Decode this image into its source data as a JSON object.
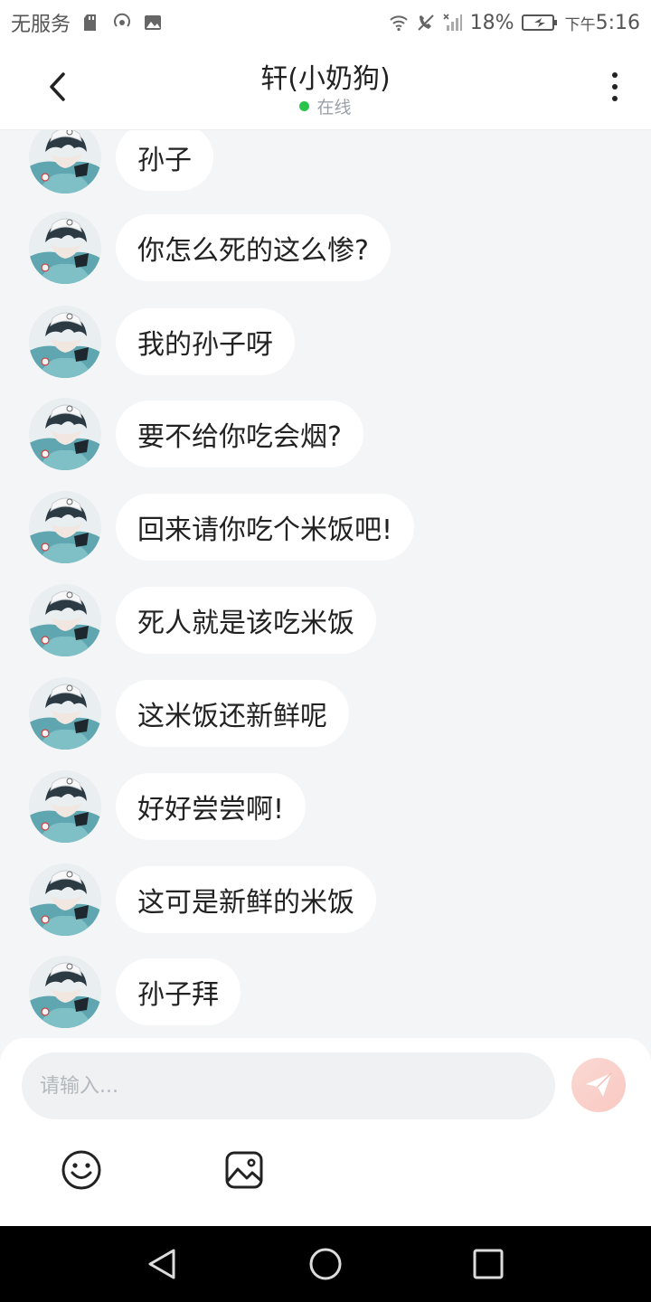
{
  "status_bar": {
    "carrier": "无服务",
    "battery": "18%",
    "time_prefix": "下午",
    "time": "5:16",
    "icons": [
      "sd-card-icon",
      "hotspot-icon",
      "image-icon",
      "wifi-icon",
      "call-off-icon",
      "signal-off-icon",
      "battery-charging-icon"
    ]
  },
  "header": {
    "back_icon": "chevron-left-icon",
    "title": "轩(小奶狗)",
    "status_text": "在线",
    "status_color": "#29c54a",
    "more_icon": "more-vertical-icon"
  },
  "messages": [
    {
      "text": "孙子"
    },
    {
      "text": "你怎么死的这么惨?"
    },
    {
      "text": "我的孙子呀"
    },
    {
      "text": "要不给你吃会烟?"
    },
    {
      "text": "回来请你吃个米饭吧!"
    },
    {
      "text": "死人就是该吃米饭"
    },
    {
      "text": "这米饭还新鲜呢"
    },
    {
      "text": "好好尝尝啊!"
    },
    {
      "text": "这可是新鲜的米饭"
    },
    {
      "text": "孙子拜"
    }
  ],
  "composer": {
    "input_value": "",
    "input_placeholder": "请输入...",
    "send_icon": "paper-plane-icon",
    "emoji_icon": "smiley-icon",
    "image_icon": "image-picker-icon"
  },
  "navbar": {
    "icons": [
      "back-triangle-icon",
      "home-circle-icon",
      "recents-square-icon"
    ]
  },
  "colors": {
    "background": "#f4f5f7",
    "bubble": "#ffffff",
    "send_button": "#f9c9c2",
    "online": "#29c54a"
  }
}
